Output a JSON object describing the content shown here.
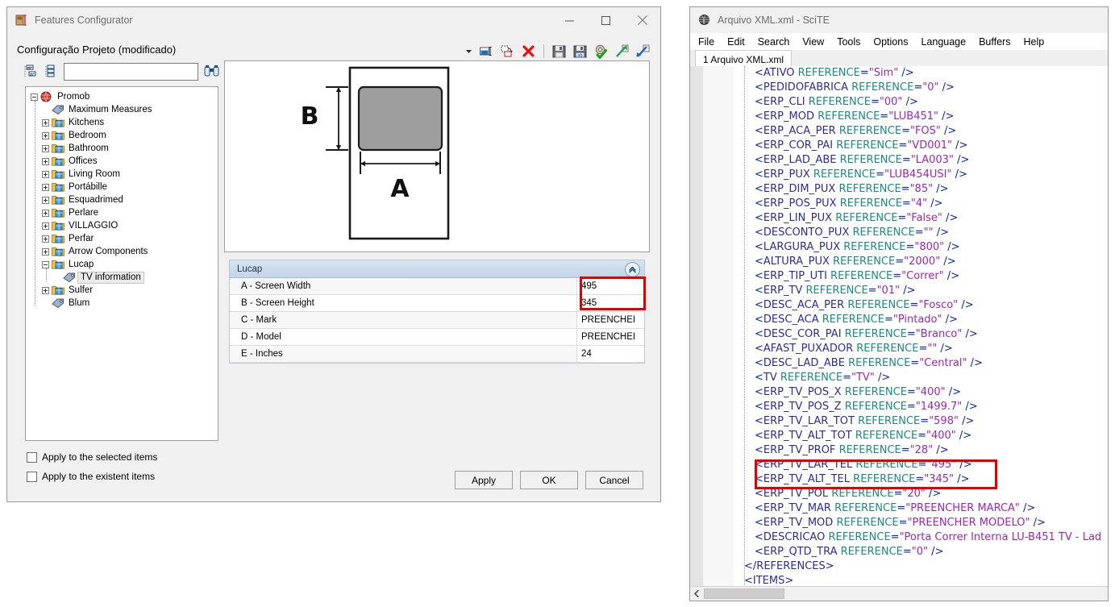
{
  "configurator": {
    "title": "Features Configurator",
    "title_icon": "features-configurator-icon",
    "subtitle": "Configuração Projeto (modificado)",
    "window_buttons": {
      "minimize": "minimize-icon",
      "maximize": "maximize-icon",
      "close": "close-icon"
    },
    "toolbar": {
      "items": [
        {
          "name": "dropdown-arrow",
          "tip": "More"
        },
        {
          "name": "rename-icon",
          "tip": "Rename"
        },
        {
          "name": "duplicate-icon",
          "tip": "Duplicate"
        },
        {
          "name": "delete-icon",
          "tip": "Delete"
        },
        {
          "name": "save-icon",
          "tip": "Save"
        },
        {
          "name": "save-as-icon",
          "tip": "Save As"
        },
        {
          "name": "settings-check-icon",
          "tip": "Validate"
        },
        {
          "name": "export-icon",
          "tip": "Export"
        },
        {
          "name": "import-icon",
          "tip": "Import"
        }
      ]
    },
    "search": {
      "value": "",
      "placeholder": "",
      "find_icon": "binoculars-icon",
      "expand_all_icon": "expand-tree-icon",
      "collapse_all_icon": "collapse-tree-icon"
    },
    "tree": {
      "nodes": [
        {
          "label": "Promob",
          "level": 0,
          "icon": "globe-icon",
          "state": "expanded",
          "selected": false
        },
        {
          "label": "Maximum Measures",
          "level": 1,
          "icon": "tag-icon",
          "state": "leaf",
          "selected": false
        },
        {
          "label": "Kitchens",
          "level": 1,
          "icon": "folder-icon",
          "state": "collapsed",
          "selected": false
        },
        {
          "label": "Bedroom",
          "level": 1,
          "icon": "folder-icon",
          "state": "collapsed",
          "selected": false
        },
        {
          "label": "Bathroom",
          "level": 1,
          "icon": "folder-icon",
          "state": "collapsed",
          "selected": false
        },
        {
          "label": "Offices",
          "level": 1,
          "icon": "folder-icon",
          "state": "collapsed",
          "selected": false
        },
        {
          "label": "Living Room",
          "level": 1,
          "icon": "folder-icon",
          "state": "collapsed",
          "selected": false
        },
        {
          "label": "Portábille",
          "level": 1,
          "icon": "folder-icon",
          "state": "collapsed",
          "selected": false
        },
        {
          "label": "Esquadrimed",
          "level": 1,
          "icon": "folder-icon",
          "state": "collapsed",
          "selected": false
        },
        {
          "label": "Perlare",
          "level": 1,
          "icon": "folder-icon",
          "state": "collapsed",
          "selected": false
        },
        {
          "label": "VILLAGGIO",
          "level": 1,
          "icon": "folder-icon",
          "state": "collapsed",
          "selected": false
        },
        {
          "label": "Perfar",
          "level": 1,
          "icon": "folder-icon",
          "state": "collapsed",
          "selected": false
        },
        {
          "label": "Arrow Components",
          "level": 1,
          "icon": "folder-icon",
          "state": "collapsed",
          "selected": false
        },
        {
          "label": "Lucap",
          "level": 1,
          "icon": "folder-icon",
          "state": "expanded",
          "selected": false
        },
        {
          "label": "TV information",
          "level": 2,
          "icon": "tag-icon",
          "state": "leaf",
          "selected": true
        },
        {
          "label": "Sulfer",
          "level": 1,
          "icon": "folder-icon",
          "state": "collapsed",
          "selected": false
        },
        {
          "label": "Blum",
          "level": 1,
          "icon": "tag-icon",
          "state": "leaf",
          "selected": false
        }
      ]
    },
    "preview": {
      "name": "tv-panel-diagram",
      "width_label": "A",
      "height_label": "B"
    },
    "property_grid": {
      "group_title": "Lucap",
      "collapse_icon": "chevron-up-icon",
      "rows": [
        {
          "name": "A - Screen Width",
          "value": "495",
          "highlighted": true
        },
        {
          "name": "B - Screen Height",
          "value": "345",
          "highlighted": true
        },
        {
          "name": "C - Mark",
          "value": "PREENCHEI",
          "highlighted": false
        },
        {
          "name": "D - Model",
          "value": "PREENCHEI",
          "highlighted": false
        },
        {
          "name": "E - Inches",
          "value": "24",
          "highlighted": false
        }
      ],
      "highlight_color": "#e30000"
    },
    "checkboxes": [
      {
        "label": "Apply to the selected items",
        "checked": false
      },
      {
        "label": "Apply to the existent items",
        "checked": false
      }
    ],
    "buttons": [
      {
        "label": "Apply"
      },
      {
        "label": "OK"
      },
      {
        "label": "Cancel"
      }
    ]
  },
  "editor": {
    "title": "Arquivo XML.xml - SciTE",
    "title_icon": "scite-icon",
    "menu": [
      "File",
      "Edit",
      "Search",
      "View",
      "Tools",
      "Options",
      "Language",
      "Buffers",
      "Help"
    ],
    "tab": "1 Arquivo XML.xml",
    "scroll_left_icon": "scroll-left-icon",
    "highlight_color": "#e30000",
    "highlighted_lines": [
      37,
      38
    ],
    "lines": [
      {
        "tag": "ATIVO",
        "attr": "REFERENCE",
        "value": "Sim",
        "indent": 1,
        "kind": "empty"
      },
      {
        "tag": "PEDIDOFABRICA",
        "attr": "REFERENCE",
        "value": "0",
        "indent": 1,
        "kind": "empty"
      },
      {
        "tag": "ERP_CLI",
        "attr": "REFERENCE",
        "value": "00",
        "indent": 1,
        "kind": "empty"
      },
      {
        "tag": "ERP_MOD",
        "attr": "REFERENCE",
        "value": "LUB451",
        "indent": 1,
        "kind": "empty"
      },
      {
        "tag": "ERP_ACA_PER",
        "attr": "REFERENCE",
        "value": "FOS",
        "indent": 1,
        "kind": "empty"
      },
      {
        "tag": "ERP_COR_PAI",
        "attr": "REFERENCE",
        "value": "VD001",
        "indent": 1,
        "kind": "empty"
      },
      {
        "tag": "ERP_LAD_ABE",
        "attr": "REFERENCE",
        "value": "LA003",
        "indent": 1,
        "kind": "empty"
      },
      {
        "tag": "ERP_PUX",
        "attr": "REFERENCE",
        "value": "LUB454USI",
        "indent": 1,
        "kind": "empty"
      },
      {
        "tag": "ERP_DIM_PUX",
        "attr": "REFERENCE",
        "value": "85",
        "indent": 1,
        "kind": "empty"
      },
      {
        "tag": "ERP_POS_PUX",
        "attr": "REFERENCE",
        "value": "4",
        "indent": 1,
        "kind": "empty"
      },
      {
        "tag": "ERP_LIN_PUX",
        "attr": "REFERENCE",
        "value": "False",
        "indent": 1,
        "kind": "empty"
      },
      {
        "tag": "DESCONTO_PUX",
        "attr": "REFERENCE",
        "value": "",
        "indent": 1,
        "kind": "empty"
      },
      {
        "tag": "LARGURA_PUX",
        "attr": "REFERENCE",
        "value": "800",
        "indent": 1,
        "kind": "empty"
      },
      {
        "tag": "ALTURA_PUX",
        "attr": "REFERENCE",
        "value": "2000",
        "indent": 1,
        "kind": "empty"
      },
      {
        "tag": "ERP_TIP_UTI",
        "attr": "REFERENCE",
        "value": "Correr",
        "indent": 1,
        "kind": "empty"
      },
      {
        "tag": "ERP_TV",
        "attr": "REFERENCE",
        "value": "01",
        "indent": 1,
        "kind": "empty"
      },
      {
        "tag": "DESC_ACA_PER",
        "attr": "REFERENCE",
        "value": "Fosco",
        "indent": 1,
        "kind": "empty"
      },
      {
        "tag": "DESC_ACA",
        "attr": "REFERENCE",
        "value": "Pintado",
        "indent": 1,
        "kind": "empty"
      },
      {
        "tag": "DESC_COR_PAI",
        "attr": "REFERENCE",
        "value": "Branco",
        "indent": 1,
        "kind": "empty"
      },
      {
        "tag": "AFAST_PUXADOR",
        "attr": "REFERENCE",
        "value": "",
        "indent": 1,
        "kind": "empty"
      },
      {
        "tag": "DESC_LAD_ABE",
        "attr": "REFERENCE",
        "value": "Central",
        "indent": 1,
        "kind": "empty"
      },
      {
        "tag": "TV",
        "attr": "REFERENCE",
        "value": "TV",
        "indent": 1,
        "kind": "empty"
      },
      {
        "tag": "ERP_TV_POS_X",
        "attr": "REFERENCE",
        "value": "400",
        "indent": 1,
        "kind": "empty"
      },
      {
        "tag": "ERP_TV_POS_Z",
        "attr": "REFERENCE",
        "value": "1499.7",
        "indent": 1,
        "kind": "empty"
      },
      {
        "tag": "ERP_TV_LAR_TOT",
        "attr": "REFERENCE",
        "value": "598",
        "indent": 1,
        "kind": "empty"
      },
      {
        "tag": "ERP_TV_ALT_TOT",
        "attr": "REFERENCE",
        "value": "400",
        "indent": 1,
        "kind": "empty"
      },
      {
        "tag": "ERP_TV_PROF",
        "attr": "REFERENCE",
        "value": "28",
        "indent": 1,
        "kind": "empty"
      },
      {
        "tag": "ERP_TV_LAR_TEL",
        "attr": "REFERENCE",
        "value": "495",
        "indent": 1,
        "kind": "empty"
      },
      {
        "tag": "ERP_TV_ALT_TEL",
        "attr": "REFERENCE",
        "value": "345",
        "indent": 1,
        "kind": "empty"
      },
      {
        "tag": "ERP_TV_POL",
        "attr": "REFERENCE",
        "value": "20",
        "indent": 1,
        "kind": "empty"
      },
      {
        "tag": "ERP_TV_MAR",
        "attr": "REFERENCE",
        "value": "PREENCHER MARCA",
        "indent": 1,
        "kind": "empty"
      },
      {
        "tag": "ERP_TV_MOD",
        "attr": "REFERENCE",
        "value": "PREENCHER MODELO",
        "indent": 1,
        "kind": "empty"
      },
      {
        "tag": "DESCRICAO",
        "attr": "REFERENCE",
        "value": "Porta Correr Interna LU-B451 TV - Lad",
        "indent": 1,
        "kind": "clipped"
      },
      {
        "tag": "ERP_QTD_TRA",
        "attr": "REFERENCE",
        "value": "0",
        "indent": 1,
        "kind": "empty"
      },
      {
        "tag": "REFERENCES",
        "attr": "",
        "value": "",
        "indent": 0,
        "kind": "close"
      },
      {
        "tag": "ITEMS",
        "attr": "",
        "value": "",
        "indent": 0,
        "kind": "open"
      }
    ]
  }
}
